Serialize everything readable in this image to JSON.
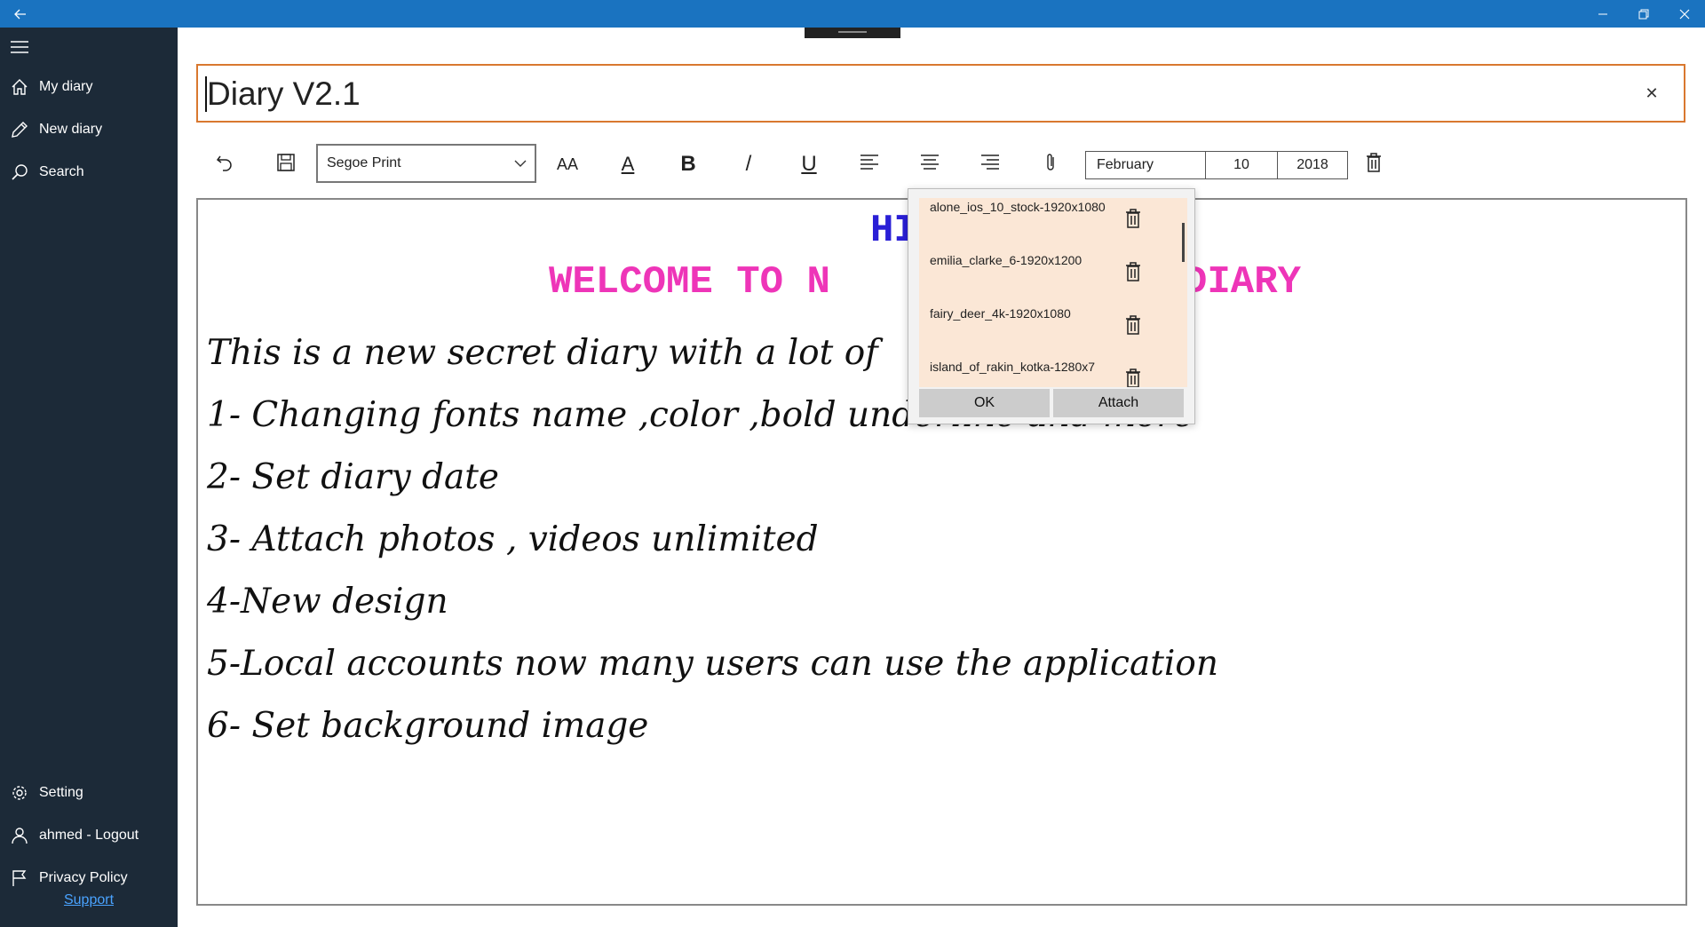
{
  "titlebar": {
    "back_icon": "back-arrow-icon",
    "minimize": "minimize-icon",
    "restore": "restore-icon",
    "close": "close-icon"
  },
  "sidebar": {
    "menu_icon": "hamburger-icon",
    "items": [
      {
        "label": "My diary",
        "icon": "home-icon"
      },
      {
        "label": "New diary",
        "icon": "pencil-icon"
      },
      {
        "label": "Search",
        "icon": "search-icon"
      }
    ],
    "bottom_items": [
      {
        "label": "Setting",
        "icon": "gear-icon"
      },
      {
        "label": "ahmed - Logout",
        "icon": "person-icon"
      },
      {
        "label": "Privacy Policy",
        "icon": "flag-icon"
      }
    ],
    "support_label": "Support"
  },
  "title": {
    "value": "Diary V2.1"
  },
  "toolbar": {
    "font_name": "Segoe Print",
    "font_size_glyph": "AA",
    "font_color_glyph": "A",
    "bold_glyph": "B",
    "italic_glyph": "/",
    "underline_glyph": "U",
    "month": "February",
    "day": "10",
    "year": "2018"
  },
  "colors": {
    "titlebar": "#1a73c0",
    "sidebar": "#1c2a38",
    "accent_border": "#d9782f",
    "heading_blue": "#2a1fd6",
    "heading_pink": "#ee35b8",
    "attachment_bg": "#fbe7d6"
  },
  "editor": {
    "heading1": "HI",
    "heading2_left": "WELCOME TO N",
    "heading2_right": "DIARY",
    "lines": [
      "This is a new secret diary with a lot of",
      "1- Changing fonts name ,color ,bold underline and more",
      "2- Set diary date",
      "3- Attach photos , videos unlimited",
      "4-New design",
      "5-Local accounts now many users can use the application",
      "6- Set background image"
    ]
  },
  "attachments": {
    "items": [
      "alone_ios_10_stock-1920x1080",
      "emilia_clarke_6-1920x1200",
      "fairy_deer_4k-1920x1080",
      "island_of_rakin_kotka-1280x7"
    ],
    "ok_label": "OK",
    "attach_label": "Attach"
  }
}
